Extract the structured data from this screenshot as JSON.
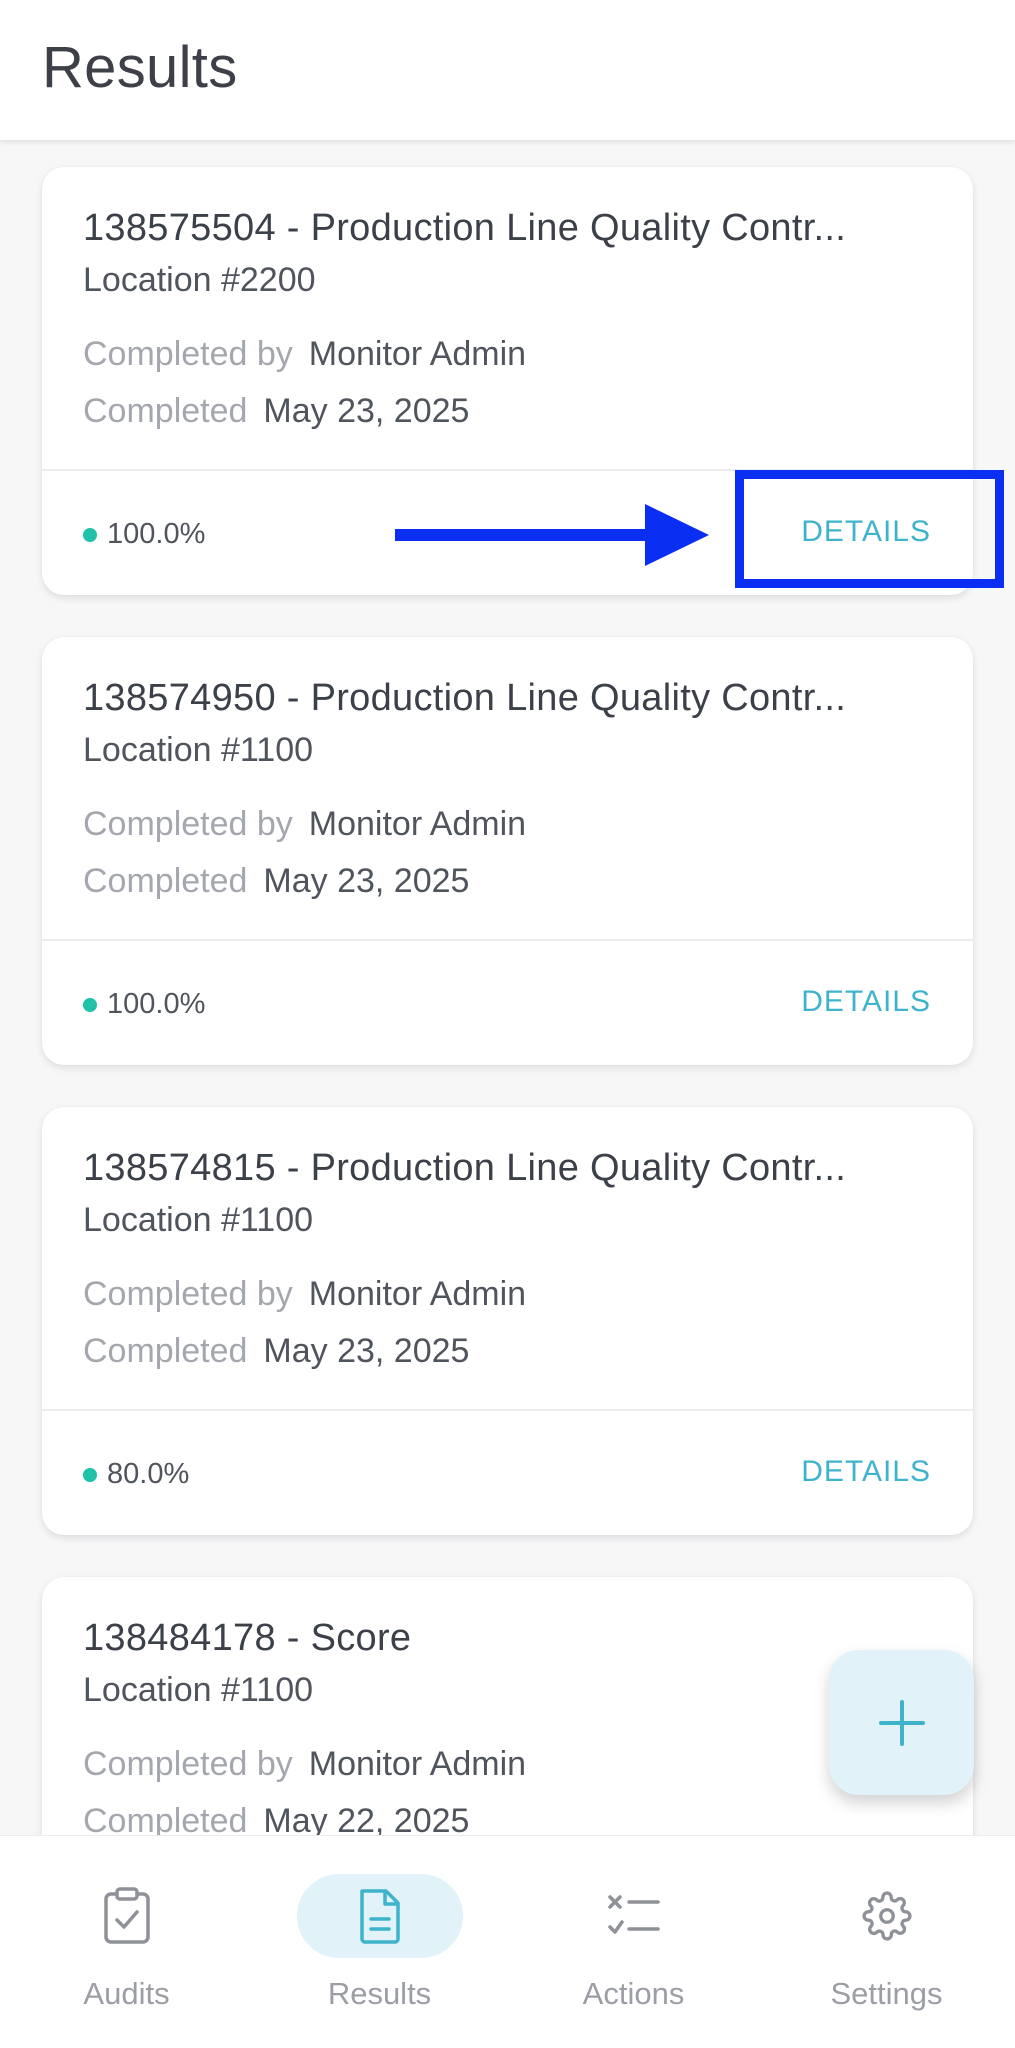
{
  "header": {
    "title": "Results"
  },
  "labels": {
    "completed_by": "Completed by",
    "completed": "Completed",
    "details": "DETAILS"
  },
  "results": [
    {
      "title": "138575504 - Production Line Quality Contr...",
      "location": "Location #2200",
      "completed_by": "Monitor Admin",
      "completed_date": "May 23, 2025",
      "score": "100.0%"
    },
    {
      "title": "138574950 - Production Line Quality Contr...",
      "location": "Location #1100",
      "completed_by": "Monitor Admin",
      "completed_date": "May 23, 2025",
      "score": "100.0%"
    },
    {
      "title": "138574815 - Production Line Quality Contr...",
      "location": "Location #1100",
      "completed_by": "Monitor Admin",
      "completed_date": "May 23, 2025",
      "score": "80.0%"
    },
    {
      "title": "138484178 - Score",
      "location": "Location #1100",
      "completed_by": "Monitor Admin",
      "completed_date": "May 22, 2025",
      "score": ""
    }
  ],
  "fab": {
    "icon": "plus-icon"
  },
  "nav": [
    {
      "label": "Audits",
      "icon": "clipboard-check-icon",
      "active": false
    },
    {
      "label": "Results",
      "icon": "document-icon",
      "active": true
    },
    {
      "label": "Actions",
      "icon": "checklist-icon",
      "active": false
    },
    {
      "label": "Settings",
      "icon": "gear-icon",
      "active": false
    }
  ],
  "colors": {
    "accent": "#3fb3cc",
    "score_dot": "#1fc2a8",
    "annotation": "#0a2ff2",
    "active_pill": "#e1f2f9"
  }
}
